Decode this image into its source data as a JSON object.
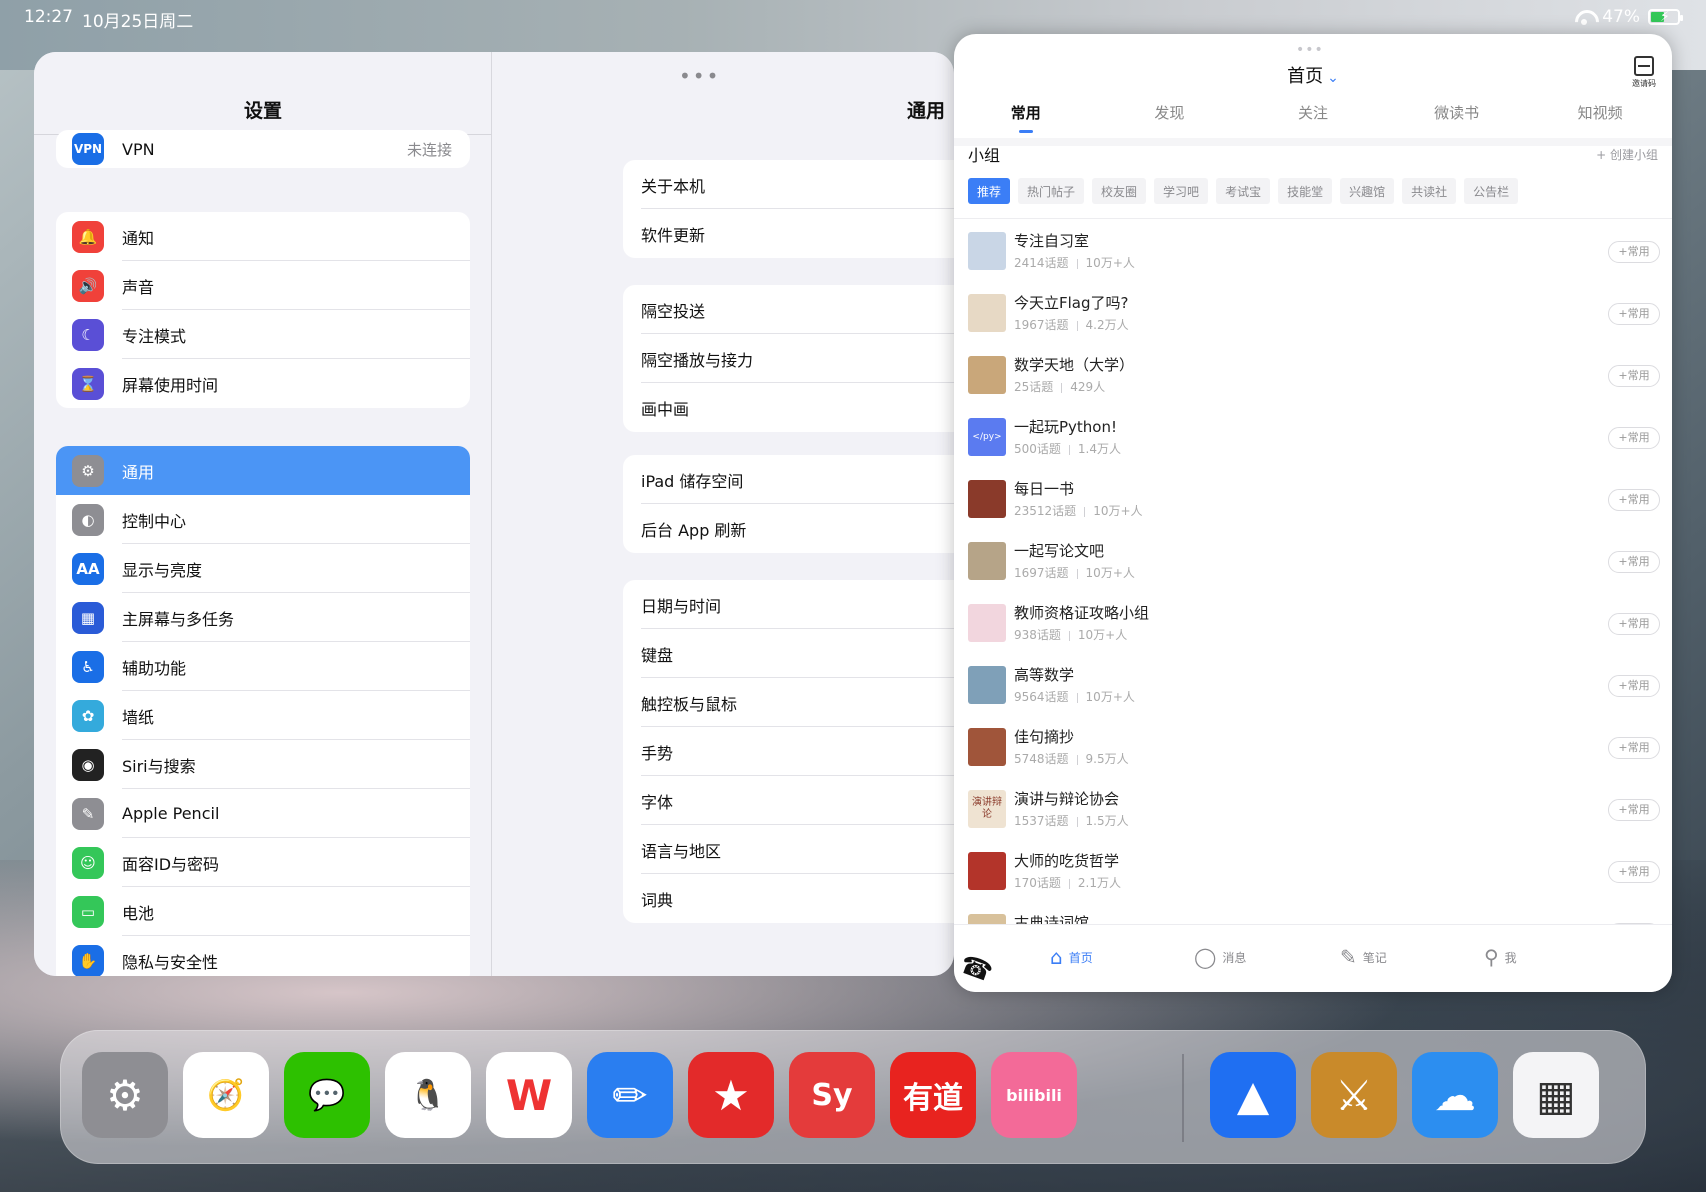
{
  "status_bar": {
    "time": "12:27",
    "date": "10月25日周二",
    "battery": "47%"
  },
  "settings": {
    "sidebar_title": "设置",
    "vpn": {
      "label": "VPN",
      "value": "未连接",
      "icon": "vpn-icon",
      "color": "#1a6ee6"
    },
    "group1": [
      {
        "label": "通知",
        "icon": "bell-icon",
        "color": "#f0413a"
      },
      {
        "label": "声音",
        "icon": "speaker-icon",
        "color": "#f0413a"
      },
      {
        "label": "专注模式",
        "icon": "moon-icon",
        "color": "#5a4fd6"
      },
      {
        "label": "屏幕使用时间",
        "icon": "hourglass-icon",
        "color": "#5a4fd6"
      }
    ],
    "group2": [
      {
        "label": "通用",
        "icon": "gear-icon",
        "color": "#8e8e93",
        "active": true
      },
      {
        "label": "控制中心",
        "icon": "toggles-icon",
        "color": "#8e8e93"
      },
      {
        "label": "显示与亮度",
        "icon": "text-size-icon",
        "color": "#1a6ee6"
      },
      {
        "label": "主屏幕与多任务",
        "icon": "grid-icon",
        "color": "#2a5bd7"
      },
      {
        "label": "辅助功能",
        "icon": "accessibility-icon",
        "color": "#1a6ee6"
      },
      {
        "label": "墙纸",
        "icon": "flower-icon",
        "color": "#34aadc"
      },
      {
        "label": "Siri与搜索",
        "icon": "siri-icon",
        "color": "#222"
      },
      {
        "label": "Apple Pencil",
        "icon": "pencil-icon",
        "color": "#8e8e93"
      },
      {
        "label": "面容ID与密码",
        "icon": "face-id-icon",
        "color": "#34c759"
      },
      {
        "label": "电池",
        "icon": "battery-icon",
        "color": "#34c759"
      },
      {
        "label": "隐私与安全性",
        "icon": "hand-icon",
        "color": "#1a6ee6"
      }
    ],
    "detail_title": "通用",
    "detail_groups": [
      [
        "关于本机",
        "软件更新"
      ],
      [
        "隔空投送",
        "隔空播放与接力",
        "画中画"
      ],
      [
        "iPad 储存空间",
        "后台 App 刷新"
      ],
      [
        "日期与时间",
        "键盘",
        "触控板与鼠标",
        "手势",
        "字体",
        "语言与地区",
        "词典"
      ]
    ]
  },
  "app": {
    "title": "首页",
    "scan_label": "邀请码",
    "tabs": [
      "常用",
      "发现",
      "关注",
      "微读书",
      "知视频"
    ],
    "section_title": "小组",
    "create_label": "+ 创建小组",
    "chips": [
      "推荐",
      "热门帖子",
      "校友圈",
      "学习吧",
      "考试宝",
      "技能堂",
      "兴趣馆",
      "共读社",
      "公告栏"
    ],
    "add_label": "+常用",
    "groups": [
      {
        "name": "专注自习室",
        "topics": "2414话题",
        "members": "10万+人",
        "thumb": "#c9d6e6"
      },
      {
        "name": "今天立Flag了吗?",
        "topics": "1967话题",
        "members": "4.2万人",
        "thumb": "#e7d9c5"
      },
      {
        "name": "数学天地（大学）",
        "topics": "25话题",
        "members": "429人",
        "thumb": "#c9a77a"
      },
      {
        "name": "一起玩Python!",
        "topics": "500话题",
        "members": "1.4万人",
        "thumb": "#5b7bf0"
      },
      {
        "name": "每日一书",
        "topics": "23512话题",
        "members": "10万+人",
        "thumb": "#8a3a2a"
      },
      {
        "name": "一起写论文吧",
        "topics": "1697话题",
        "members": "10万+人",
        "thumb": "#b6a488"
      },
      {
        "name": "教师资格证攻略小组",
        "topics": "938话题",
        "members": "10万+人",
        "thumb": "#f2d6de"
      },
      {
        "name": "高等数学",
        "topics": "9564话题",
        "members": "10万+人",
        "thumb": "#7fa0b8"
      },
      {
        "name": "佳句摘抄",
        "topics": "5748话题",
        "members": "9.5万人",
        "thumb": "#a0553a"
      },
      {
        "name": "演讲与辩论协会",
        "topics": "1537话题",
        "members": "1.5万人",
        "thumb": "#efe3d2"
      },
      {
        "name": "大师的吃货哲学",
        "topics": "170话题",
        "members": "2.1万人",
        "thumb": "#b3342a"
      },
      {
        "name": "古典诗词馆",
        "topics": "",
        "members": "",
        "thumb": "#d8c19b"
      }
    ],
    "thumb_texts": {
      "python": "</py>",
      "speech": "演讲辩论"
    },
    "nav": [
      {
        "label": "首页",
        "icon": "home-icon",
        "active": true
      },
      {
        "label": "消息",
        "icon": "chat-bubble-icon"
      },
      {
        "label": "笔记",
        "icon": "note-edit-icon"
      },
      {
        "label": "我",
        "icon": "person-icon"
      }
    ]
  },
  "dock": {
    "apps": [
      {
        "name": "settings-app",
        "color": "#8e8e93",
        "glyph": "⚙"
      },
      {
        "name": "safari-app",
        "color": "#ffffff",
        "glyph": "🧭"
      },
      {
        "name": "wechat-app",
        "color": "#2dc100",
        "glyph": "💬"
      },
      {
        "name": "qq-app",
        "color": "#ffffff",
        "glyph": "🐧"
      },
      {
        "name": "wps-app",
        "color": "#ffffff",
        "glyph": "W"
      },
      {
        "name": "pencil-app",
        "color": "#2a7ef0",
        "glyph": "✏"
      },
      {
        "name": "xuexitong-app",
        "color": "#e32a2a",
        "glyph": "★"
      },
      {
        "name": "sy-app",
        "color": "#e43b3b",
        "glyph": "Sy"
      },
      {
        "name": "youdao-app",
        "color": "#e8231f",
        "glyph": "有道"
      },
      {
        "name": "bilibili-app",
        "color": "#f36a98",
        "glyph": "bilibili"
      },
      {
        "name": "lanhu-app",
        "color": "#1f6ff2",
        "glyph": "▲"
      },
      {
        "name": "clash-app",
        "color": "#c98a2a",
        "glyph": "⚔"
      },
      {
        "name": "weather-app",
        "color": "#2c8ef0",
        "glyph": "☁"
      },
      {
        "name": "app-library-folder",
        "color": "#f4f4f6",
        "glyph": "▦"
      }
    ]
  }
}
